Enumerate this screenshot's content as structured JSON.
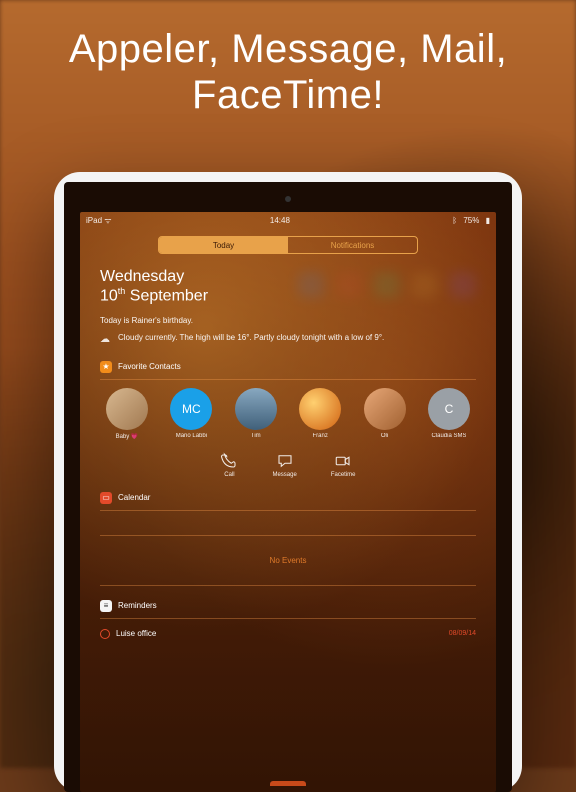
{
  "headline_line1": "Appeler, Message, Mail,",
  "headline_line2": "FaceTime!",
  "status": {
    "carrier": "iPad",
    "wifi": "ᯤ",
    "time": "14:48",
    "battery_pct": "75%",
    "bt": "ᛒ"
  },
  "segmented": {
    "today": "Today",
    "notifications": "Notifications"
  },
  "date": {
    "weekday": "Wednesday",
    "daynum": "10",
    "ordinal": "th",
    "month": "September"
  },
  "summary": "Today is Rainer's birthday.",
  "weather": {
    "icon": "☁",
    "text": "Cloudy currently. The high will be 16°. Partly cloudy tonight with a low of 9°."
  },
  "sections": {
    "favorites": {
      "title": "Favorite Contacts",
      "contacts": [
        {
          "name": "Baby 💗",
          "initials": "",
          "bg": "linear-gradient(135deg,#d8b890,#a07850)"
        },
        {
          "name": "Mario Labbi",
          "initials": "MC",
          "bg": "#1aa0e8"
        },
        {
          "name": "Tim",
          "initials": "",
          "bg": "linear-gradient(180deg,#88a8c0,#40607a)"
        },
        {
          "name": "Franz",
          "initials": "",
          "bg": "radial-gradient(circle at 35% 35%,#ffd070,#d06010)"
        },
        {
          "name": "Oli",
          "initials": "",
          "bg": "linear-gradient(135deg,#e8a878,#a06030)"
        },
        {
          "name": "Claudia SMS",
          "initials": "C",
          "bg": "#9aa0a6"
        }
      ],
      "actions": {
        "call": "Call",
        "message": "Message",
        "facetime": "Facetime"
      }
    },
    "calendar": {
      "title": "Calendar",
      "empty": "No Events"
    },
    "reminders": {
      "title": "Reminders",
      "items": [
        {
          "text": "Luise office",
          "due": "08/09/14"
        }
      ]
    }
  }
}
